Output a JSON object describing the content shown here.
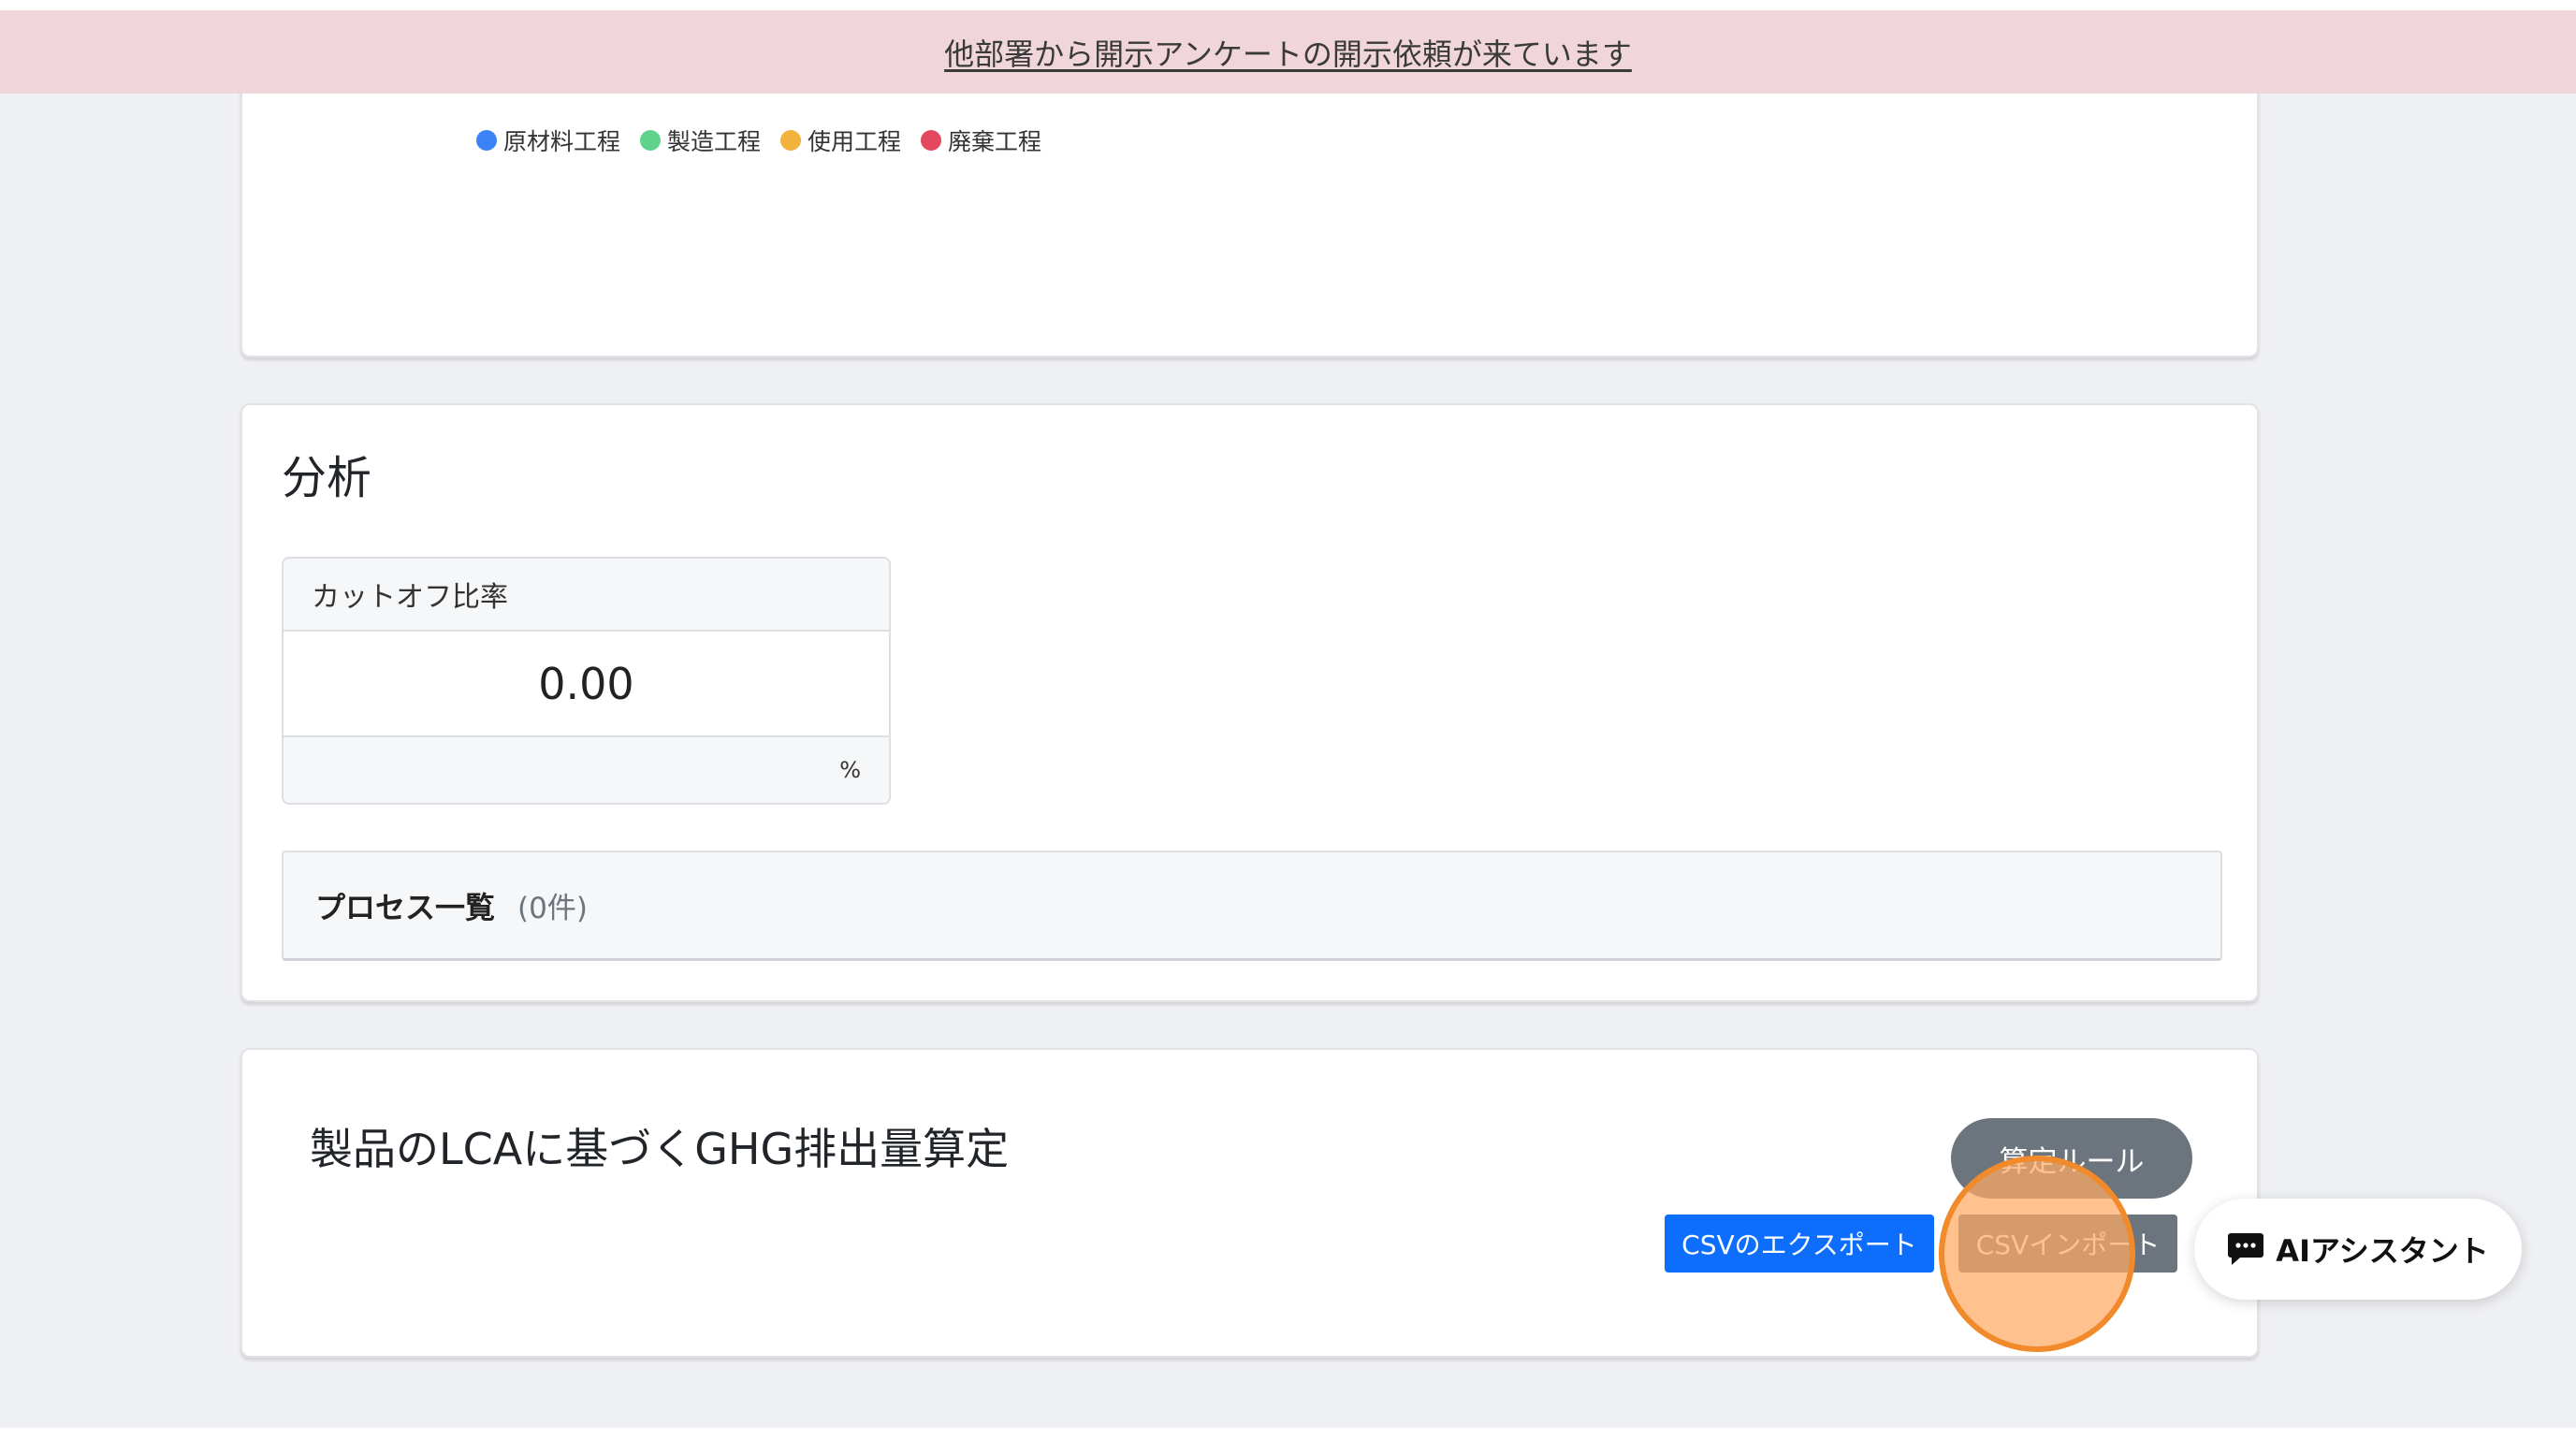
{
  "banner": {
    "text": "他部署から開示アンケートの開示依頼が来ています"
  },
  "chart_section": {
    "legend": [
      {
        "label": "原材料工程",
        "color": "#3b82f6"
      },
      {
        "label": "製造工程",
        "color": "#5fd28b"
      },
      {
        "label": "使用工程",
        "color": "#f2b23e"
      },
      {
        "label": "廃棄工程",
        "color": "#e2495e"
      }
    ]
  },
  "analysis": {
    "title": "分析",
    "cutoff": {
      "label": "カットオフ比率",
      "value": "0.00",
      "unit": "%"
    },
    "process_list": {
      "title": "プロセス一覧",
      "count": "(0件)"
    }
  },
  "ghg": {
    "title": "製品のLCAに基づくGHG排出量算定",
    "rule_button": "算定ルール",
    "export_button": "CSVのエクスポート",
    "import_button": "CSVインポート"
  },
  "ai_assistant": {
    "label": "AIアシスタント",
    "icon": "chat-icon"
  },
  "colors": {
    "banner_bg": "#f0d6da",
    "primary": "#0d6efd",
    "secondary": "#6c757d",
    "highlight": "#f08a2a"
  }
}
